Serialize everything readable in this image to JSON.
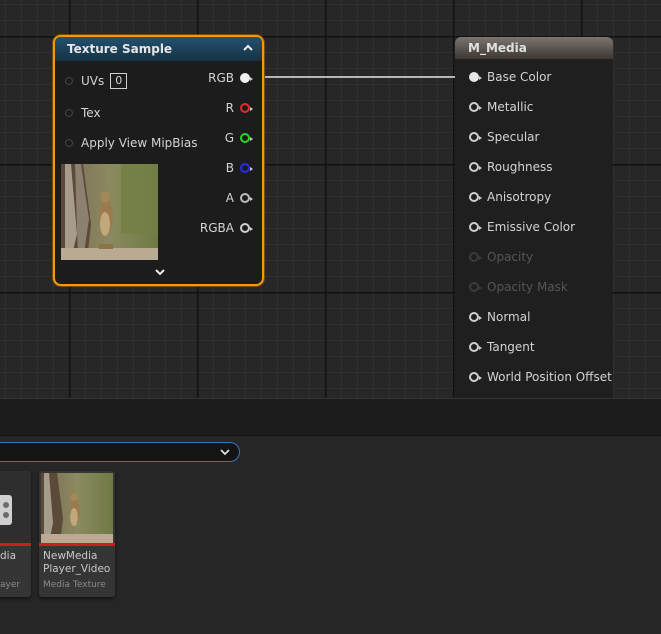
{
  "graph": {
    "texture_node": {
      "title": "Texture Sample",
      "inputs": [
        {
          "label": "UVs",
          "value": "0"
        },
        {
          "label": "Tex"
        },
        {
          "label": "Apply View MipBias"
        }
      ],
      "outputs": [
        {
          "label": "RGB",
          "color": "#ffffff"
        },
        {
          "label": "R",
          "color": "#e12b2b"
        },
        {
          "label": "G",
          "color": "#2bd42b"
        },
        {
          "label": "B",
          "color": "#2b2bf0"
        },
        {
          "label": "A",
          "color": "#bdbdbd"
        },
        {
          "label": "RGBA",
          "color": "#ffffff"
        }
      ],
      "header_color": "#1d4561",
      "selection_color": "#f29a0c"
    },
    "material_node": {
      "title": "M_Media",
      "inputs": [
        {
          "label": "Base Color",
          "connected": true
        },
        {
          "label": "Metallic"
        },
        {
          "label": "Specular"
        },
        {
          "label": "Roughness"
        },
        {
          "label": "Anisotropy"
        },
        {
          "label": "Emissive Color"
        },
        {
          "label": "Opacity",
          "disabled": true
        },
        {
          "label": "Opacity Mask",
          "disabled": true
        },
        {
          "label": "Normal"
        },
        {
          "label": "Tangent"
        },
        {
          "label": "World Position Offset"
        }
      ]
    }
  },
  "content_browser": {
    "tiles": [
      {
        "name_lines": [
          "dia",
          ""
        ],
        "type": "ayer"
      },
      {
        "name_lines": [
          "NewMedia",
          "Player_Video"
        ],
        "type": "Media Texture"
      }
    ]
  }
}
